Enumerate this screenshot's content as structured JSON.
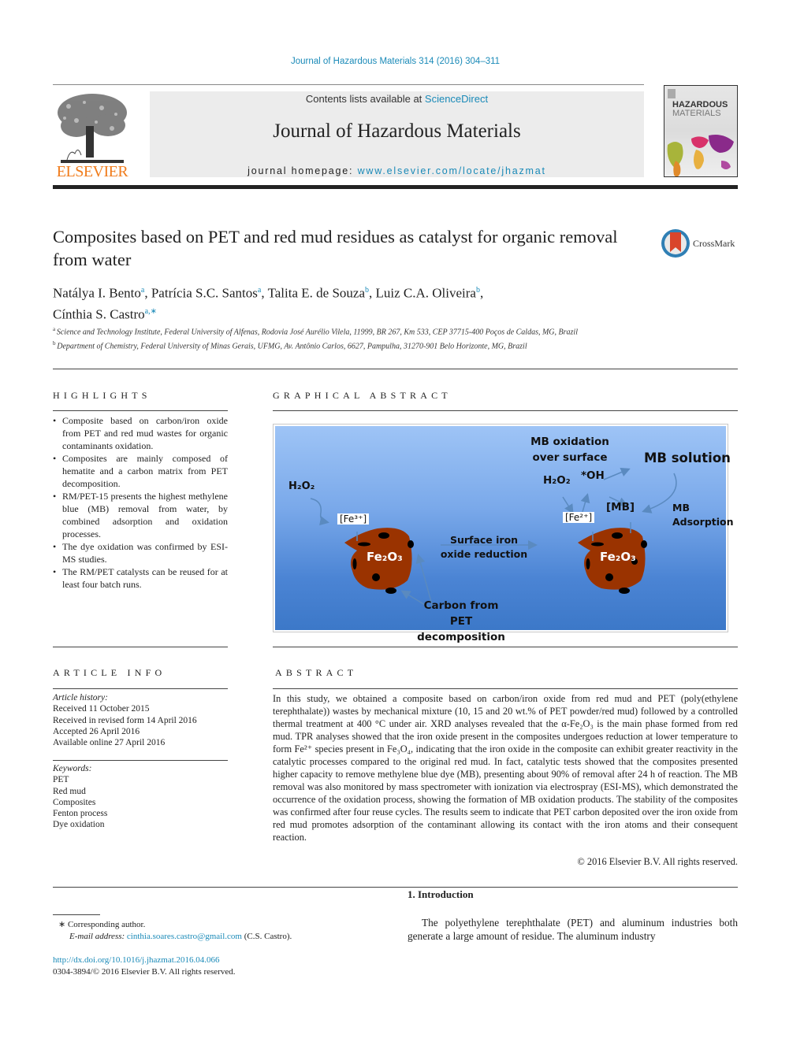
{
  "header": {
    "citation": "Journal of Hazardous Materials 314 (2016) 304–311",
    "contents_prefix": "Contents lists available at ",
    "contents_link": "ScienceDirect",
    "journal_title": "Journal of Hazardous Materials",
    "homepage_prefix": "journal homepage: ",
    "homepage_link": "www.elsevier.com/locate/jhazmat",
    "publisher_logo": "ELSEVIER",
    "cover_title_line1": "HAZARDOUS",
    "cover_title_line2": "MATERIALS",
    "crossmark_label": "CrossMark"
  },
  "article": {
    "title": "Composites based on PET and red mud residues as catalyst for organic removal from water",
    "authors": [
      {
        "name": "Natálya I. Bento",
        "aff": "a",
        "sep": ", "
      },
      {
        "name": "Patrícia S.C. Santos",
        "aff": "a",
        "sep": ", "
      },
      {
        "name": "Talita E. de Souza",
        "aff": "b",
        "sep": ", "
      },
      {
        "name": "Luiz C.A. Oliveira",
        "aff": "b",
        "sep": ","
      },
      {
        "name": "Cínthia S. Castro",
        "aff": "a,∗",
        "sep": ""
      }
    ],
    "affiliations": [
      {
        "key": "a",
        "text": "Science and Technology Institute, Federal University of Alfenas, Rodovia José Aurélio Vilela, 11999, BR 267, Km 533, CEP 37715-400 Poços de Caldas, MG, Brazil"
      },
      {
        "key": "b",
        "text": "Department of Chemistry, Federal University of Minas Gerais, UFMG, Av. Antônio Carlos, 6627, Pampulha, 31270-901 Belo Horizonte, MG, Brazil"
      }
    ]
  },
  "highlights": {
    "heading": "HIGHLIGHTS",
    "items": [
      "Composite based on carbon/iron oxide from PET and red mud wastes for organic contaminants oxidation.",
      "Composites are mainly composed of hematite and a carbon matrix from PET decomposition.",
      "RM/PET-15 presents the highest methylene blue (MB) removal from water, by combined adsorption and oxidation processes.",
      "The dye oxidation was confirmed by ESI-MS studies.",
      "The RM/PET catalysts can be reused for at least four batch runs."
    ]
  },
  "graphical_abstract": {
    "heading": "GRAPHICAL ABSTRACT",
    "labels": {
      "h2o2_left": "H₂O₂",
      "fe3": "[Fe³⁺]",
      "fe2o3_left": "Fe₂O₃",
      "surface_reduction": "Surface iron oxide reduction",
      "carbon_pet": "Carbon from PET decomposition",
      "mb_oxidation": "MB oxidation over surface",
      "mb_solution": "MB solution",
      "h2o2_right": "H₂O₂",
      "oh_radical": "*OH",
      "mb_bracket": "[MB]",
      "fe2": "[Fe²⁺]",
      "mb_adsorption": "MB Adsorption",
      "fe2o3_right": "Fe₂O₃"
    }
  },
  "article_info": {
    "heading": "ARTICLE INFO",
    "history_label": "Article history:",
    "history": [
      "Received 11 October 2015",
      "Received in revised form 14 April 2016",
      "Accepted 26 April 2016",
      "Available online 27 April 2016"
    ],
    "keywords_label": "Keywords:",
    "keywords": [
      "PET",
      "Red mud",
      "Composites",
      "Fenton process",
      "Dye oxidation"
    ]
  },
  "abstract": {
    "heading": "ABSTRACT",
    "text": "In this study, we obtained a composite based on carbon/iron oxide from red mud and PET (poly(ethylene terephthalate)) wastes by mechanical mixture (10, 15 and 20 wt.% of PET powder/red mud) followed by a controlled thermal treatment at 400 °C under air. XRD analyses revealed that the α-Fe₂O₃ is the main phase formed from red mud. TPR analyses showed that the iron oxide present in the composites undergoes reduction at lower temperature to form Fe²⁺ species present in Fe₃O₄, indicating that the iron oxide in the composite can exhibit greater reactivity in the catalytic processes compared to the original red mud. In fact, catalytic tests showed that the composites presented higher capacity to remove methylene blue dye (MB), presenting about 90% of removal after 24 h of reaction. The MB removal was also monitored by mass spectrometer with ionization via electrospray (ESI-MS), which demonstrated the occurrence of the oxidation process, showing the formation of MB oxidation products. The stability of the composites was confirmed after four reuse cycles. The results seem to indicate that PET carbon deposited over the iron oxide from red mud promotes adsorption of the contaminant allowing its contact with the iron atoms and their consequent reaction.",
    "copyright": "© 2016 Elsevier B.V. All rights reserved."
  },
  "footnote": {
    "corresponding": "∗  Corresponding author.",
    "email_label": "E-mail address: ",
    "email": "cinthia.soares.castro@gmail.com",
    "email_suffix": " (C.S. Castro).",
    "doi": "http://dx.doi.org/10.1016/j.jhazmat.2016.04.066",
    "issn": "0304-3894/© 2016 Elsevier B.V. All rights reserved."
  },
  "introduction": {
    "heading": "1.  Introduction",
    "text": "The polyethylene terephthalate (PET) and aluminum industries both generate a large amount of residue. The aluminum industry"
  }
}
